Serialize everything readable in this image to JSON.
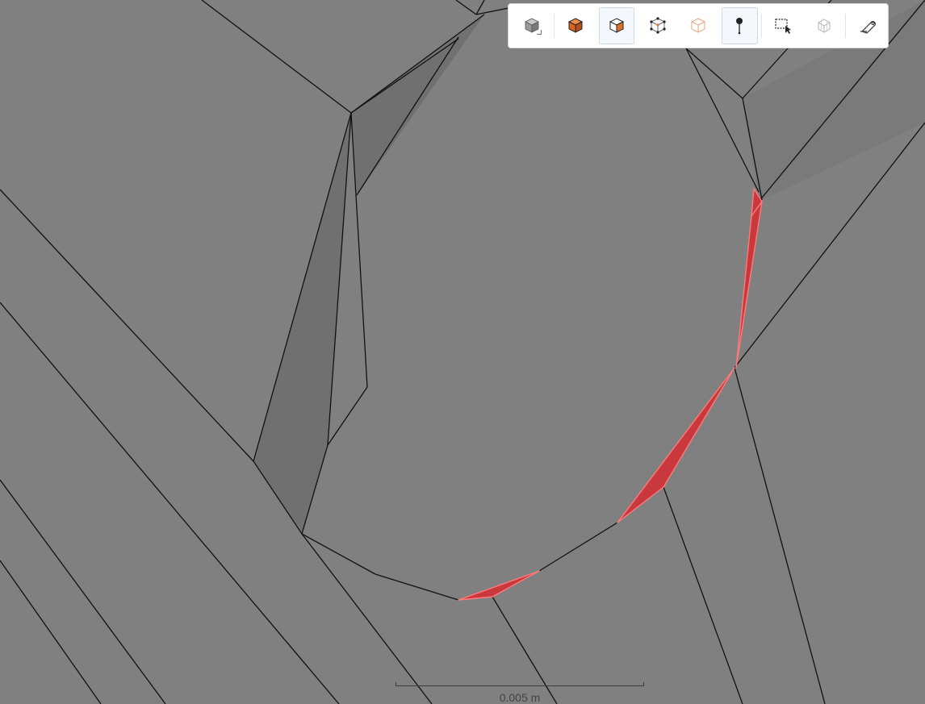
{
  "viewport": {
    "background_color": "#808080",
    "mesh_face_color": "#808080",
    "shaded_face_color": "#6e6e6e",
    "edge_color": "#111111",
    "highlight_fill_color": "#c8383c",
    "highlight_edge_color": "#ff7a7a"
  },
  "toolbar": {
    "buttons": [
      {
        "id": "view-mode",
        "icon": "gray-cube-icon",
        "active": false
      },
      {
        "id": "select-body",
        "icon": "solid-orange-cube-icon",
        "active": false
      },
      {
        "id": "select-face",
        "icon": "orange-face-cube-icon",
        "active": true
      },
      {
        "id": "select-vertex",
        "icon": "vertex-cube-icon",
        "active": false
      },
      {
        "id": "select-edge",
        "icon": "wireframe-cube-icon",
        "active": false
      },
      {
        "id": "select-point",
        "icon": "pin-icon",
        "active": true
      },
      {
        "id": "box-select",
        "icon": "box-select-icon",
        "active": false
      },
      {
        "id": "mesh-select",
        "icon": "mesh-cube-icon",
        "active": false
      },
      {
        "id": "measure",
        "icon": "measure-tape-icon",
        "active": false
      }
    ],
    "accent_color": "#e0702a"
  },
  "scale_bar": {
    "label": "0.005 m"
  }
}
